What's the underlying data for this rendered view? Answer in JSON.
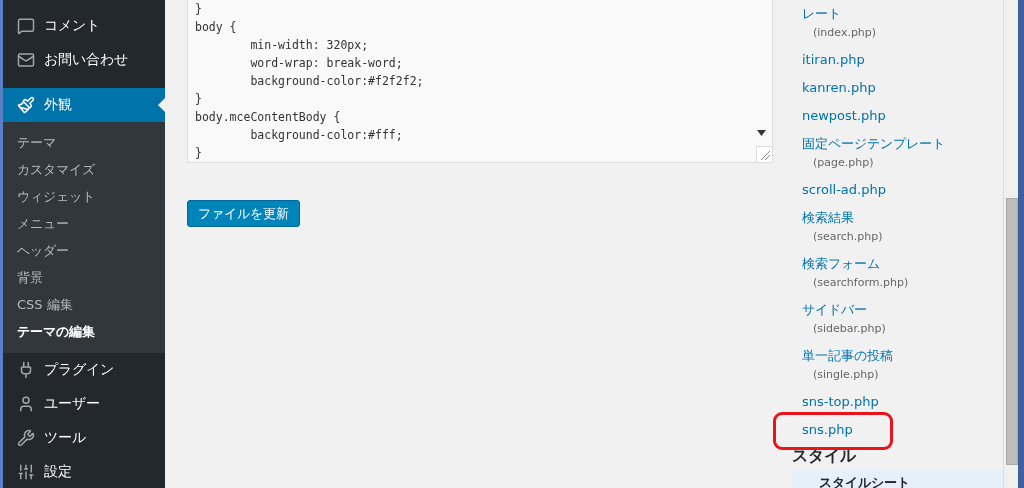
{
  "sidebar": {
    "menu": [
      {
        "label": "コメント",
        "selected": false
      },
      {
        "label": "お問い合わせ",
        "selected": false
      },
      {
        "label": "外観",
        "selected": true,
        "children": [
          {
            "label": "テーマ",
            "selected": false
          },
          {
            "label": "カスタマイズ",
            "selected": false
          },
          {
            "label": "ウィジェット",
            "selected": false
          },
          {
            "label": "メニュー",
            "selected": false
          },
          {
            "label": "ヘッダー",
            "selected": false
          },
          {
            "label": "背景",
            "selected": false
          },
          {
            "label": "CSS 編集",
            "selected": false
          },
          {
            "label": "テーマの編集",
            "selected": true
          }
        ]
      },
      {
        "label": "プラグイン",
        "selected": false
      },
      {
        "label": "ユーザー",
        "selected": false
      },
      {
        "label": "ツール",
        "selected": false
      },
      {
        "label": "設定",
        "selected": false
      }
    ]
  },
  "editor": {
    "code_lines": [
      "}",
      "body {",
      "        min-width: 320px;",
      "        word-wrap: break-word;",
      "        background-color:#f2f2f2;",
      "}",
      "body.mceContentBody {",
      "        background-color:#fff;",
      "}"
    ]
  },
  "update_button": "ファイルを更新",
  "files": {
    "items": [
      {
        "name": "レート",
        "file": "(index.php)",
        "selected": false,
        "circled": false
      },
      {
        "name": "itiran.php",
        "selected": false,
        "circled": false
      },
      {
        "name": "kanren.php",
        "selected": false,
        "circled": false
      },
      {
        "name": "newpost.php",
        "selected": false,
        "circled": false
      },
      {
        "name": "固定ページテンプレート",
        "file": "(page.php)",
        "selected": false,
        "circled": false
      },
      {
        "name": "scroll-ad.php",
        "selected": false,
        "circled": false
      },
      {
        "name": "検索結果",
        "file": "(search.php)",
        "selected": false,
        "circled": false
      },
      {
        "name": "検索フォーム",
        "file": "(searchform.php)",
        "selected": false,
        "circled": false
      },
      {
        "name": "サイドバー",
        "file": "(sidebar.php)",
        "selected": false,
        "circled": false
      },
      {
        "name": "単一記事の投稿",
        "file": "(single.php)",
        "selected": false,
        "circled": false
      },
      {
        "name": "sns-top.php",
        "selected": false,
        "circled": false
      },
      {
        "name": "sns.php",
        "selected": false,
        "circled": true
      }
    ],
    "section_heading": "スタイル",
    "style_items": [
      {
        "name": "スタイルシート",
        "selected": true,
        "circled": false
      }
    ]
  }
}
